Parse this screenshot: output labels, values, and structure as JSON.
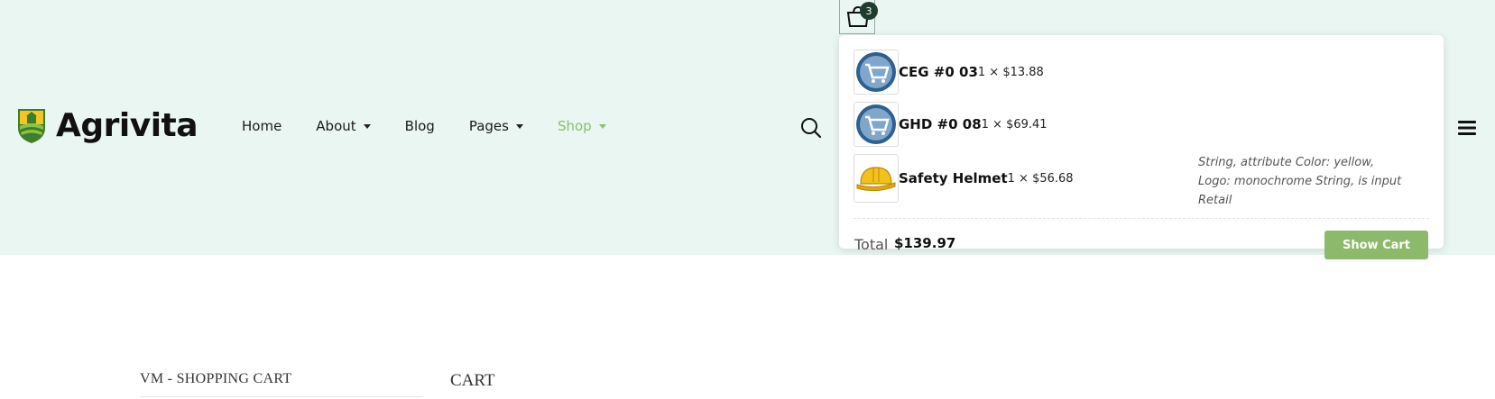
{
  "brand": {
    "name": "Agrivita",
    "logo_icon": "farm-shield-icon"
  },
  "nav": {
    "items": [
      {
        "label": "Home",
        "has_dropdown": false,
        "active": false
      },
      {
        "label": "About",
        "has_dropdown": true,
        "active": false
      },
      {
        "label": "Blog",
        "has_dropdown": false,
        "active": false
      },
      {
        "label": "Pages",
        "has_dropdown": true,
        "active": false
      },
      {
        "label": "Shop",
        "has_dropdown": true,
        "active": true
      }
    ]
  },
  "header_icons": {
    "search": "search-icon",
    "menu": "hamburger-menu-icon",
    "cart": "shopping-bag-icon"
  },
  "cart": {
    "count": "3",
    "items": [
      {
        "name": "CEG #0 03",
        "qty_price": "1 × $13.88",
        "thumb": "shopping-cart-thumb"
      },
      {
        "name": "GHD #0 08",
        "qty_price": "1 × $69.41",
        "thumb": "shopping-cart-thumb"
      },
      {
        "name": "Safety Helmet",
        "qty_price": "1 × $56.68",
        "thumb": "hard-hat-thumb",
        "attributes": "String, attribute Color: yellow, Logo: monochrome String, is input Retail"
      }
    ],
    "total_label": "Total",
    "total_value": "$139.97",
    "show_cart_label": "Show Cart"
  },
  "page": {
    "sidebar_title": "VM - SHOPPING CART",
    "content_title": "CART"
  },
  "colors": {
    "header_bg": "#eaf6f1",
    "accent": "#8cbf6a",
    "button": "#8cb96a",
    "badge": "#1f3d2e"
  }
}
